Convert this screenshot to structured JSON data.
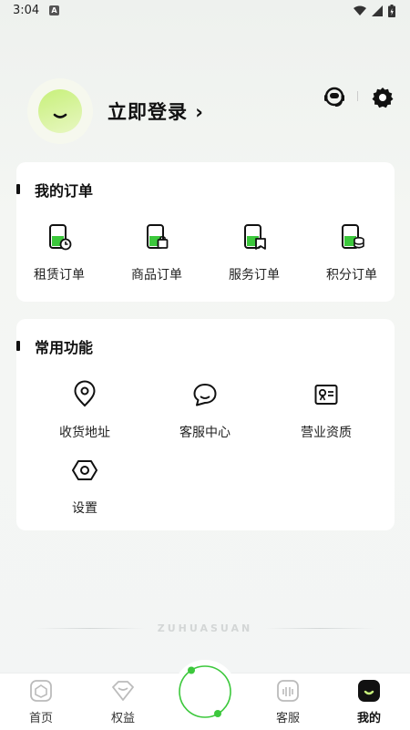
{
  "status_bar": {
    "time": "3:04",
    "notification_letter": "A"
  },
  "header": {
    "login_text": "立即登录 ›"
  },
  "orders": {
    "title": "我的订单",
    "items": [
      {
        "label": "租赁订单",
        "icon": "rental-order-icon"
      },
      {
        "label": "商品订单",
        "icon": "product-order-icon"
      },
      {
        "label": "服务订单",
        "icon": "service-order-icon"
      },
      {
        "label": "积分订单",
        "icon": "points-order-icon"
      }
    ]
  },
  "functions": {
    "title": "常用功能",
    "items": [
      {
        "label": "收货地址",
        "icon": "location-icon"
      },
      {
        "label": "客服中心",
        "icon": "chat-icon"
      },
      {
        "label": "营业资质",
        "icon": "license-icon"
      },
      {
        "label": "设置",
        "icon": "settings-icon"
      }
    ]
  },
  "watermark": "ZUHUASUAN",
  "bottom_nav": {
    "items": [
      {
        "label": "首页",
        "icon": "home-icon"
      },
      {
        "label": "权益",
        "icon": "benefits-icon"
      },
      {
        "label": "客服",
        "icon": "customer-service-icon"
      },
      {
        "label": "我的",
        "icon": "profile-icon",
        "active": true
      }
    ]
  },
  "colors": {
    "accent_green": "#3cc83c",
    "avatar_green": "#c7f07a",
    "text_dark": "#111111"
  }
}
